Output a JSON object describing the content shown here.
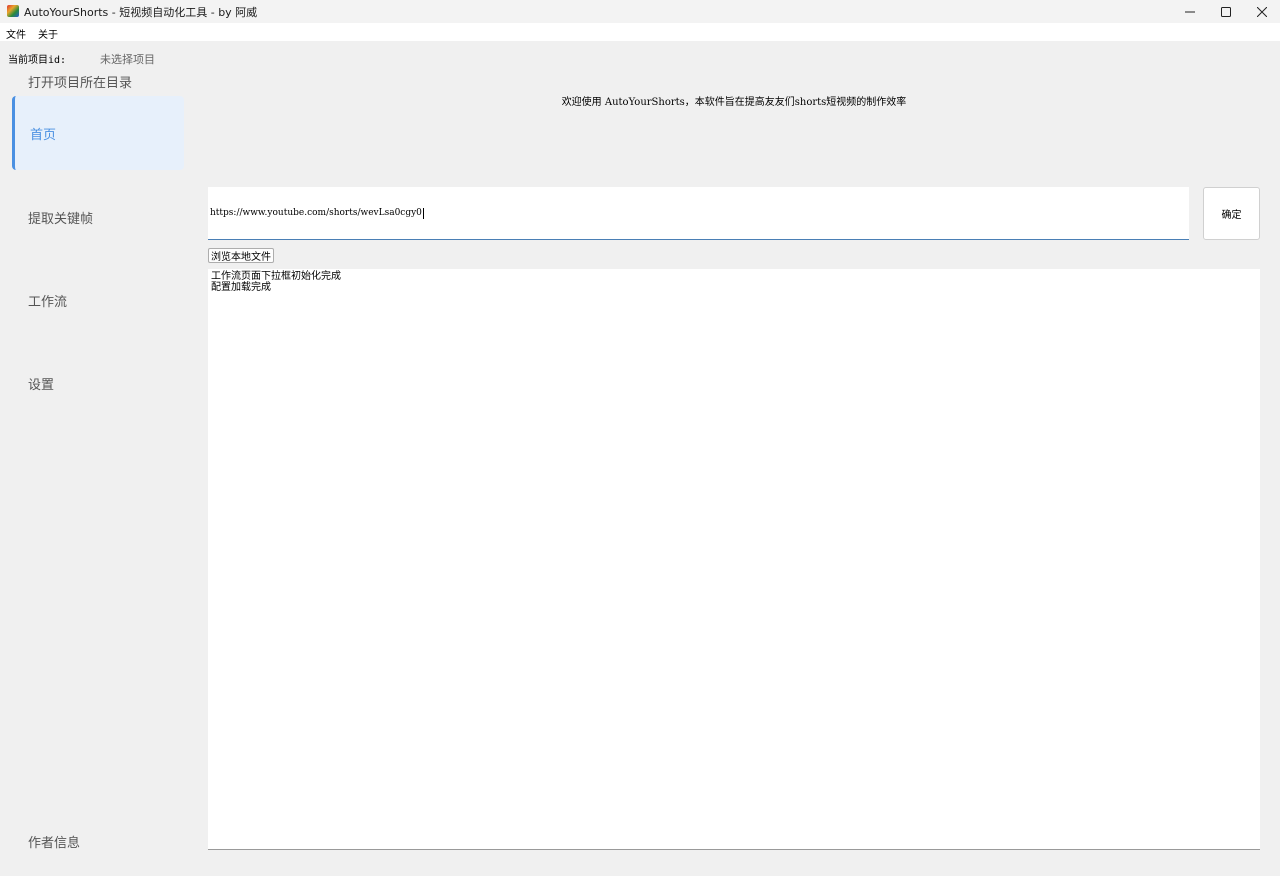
{
  "window": {
    "title": "AutoYourShorts - 短视频自动化工具 - by 阿威",
    "app_icon": "app-logo-icon",
    "minimize_icon": "minimize-icon",
    "maximize_icon": "maximize-icon",
    "close_icon": "close-icon"
  },
  "menubar": {
    "items": [
      {
        "label": "文件"
      },
      {
        "label": "关于"
      }
    ]
  },
  "project": {
    "label": "当前项目id:",
    "value": "未选择项目"
  },
  "sidebar": {
    "open_dir_label": "打开项目所在目录",
    "items": [
      {
        "label": "首页",
        "active": true
      },
      {
        "label": "提取关键帧",
        "active": false
      },
      {
        "label": "工作流",
        "active": false
      },
      {
        "label": "设置",
        "active": false
      }
    ],
    "author_label": "作者信息"
  },
  "main": {
    "welcome": "欢迎使用 AutoYourShorts，本软件旨在提高友友们shorts短视频的制作效率",
    "url_input_value": "https://www.youtube.com/shorts/wevLsa0cgy0",
    "confirm_label": "确定",
    "browse_label": "浏览本地文件",
    "log_lines": [
      "工作流页面下拉框初始化完成",
      "配置加载完成"
    ]
  },
  "colors": {
    "accent": "#4a90e2",
    "active_bg": "#e7f0fb",
    "background": "#f0f0f0"
  }
}
